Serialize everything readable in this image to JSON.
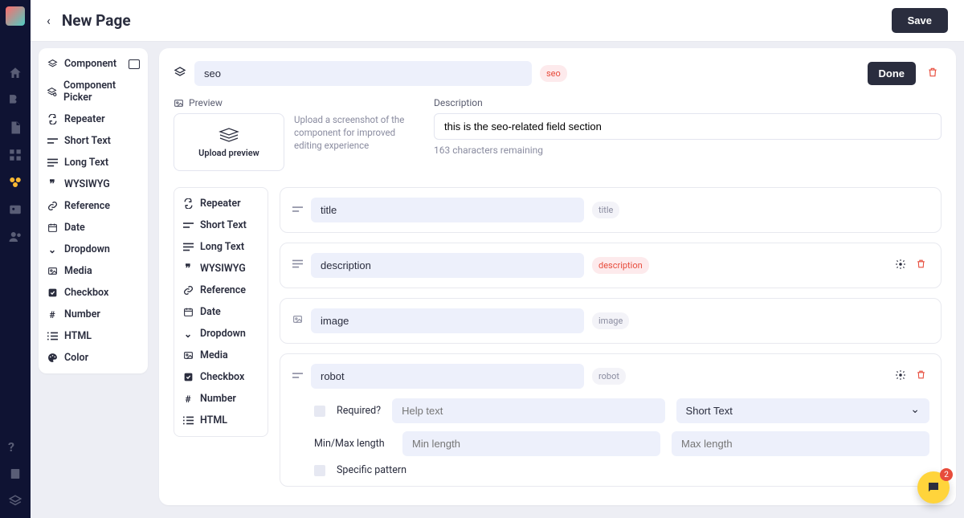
{
  "header": {
    "title": "New Page",
    "save_label": "Save"
  },
  "nav_rail": {
    "icons": [
      "home",
      "blog",
      "document",
      "grid",
      "honeycomb",
      "media",
      "users"
    ],
    "footer_icons": [
      "help",
      "book",
      "layers"
    ]
  },
  "field_types_left": [
    {
      "icon": "layers",
      "label": "Component",
      "extra": true
    },
    {
      "icon": "picker",
      "label": "Component Picker"
    },
    {
      "icon": "repeat",
      "label": "Repeater"
    },
    {
      "icon": "short",
      "label": "Short Text"
    },
    {
      "icon": "long",
      "label": "Long Text"
    },
    {
      "icon": "quote",
      "label": "WYSIWYG"
    },
    {
      "icon": "link",
      "label": "Reference"
    },
    {
      "icon": "date",
      "label": "Date"
    },
    {
      "icon": "chevron",
      "label": "Dropdown"
    },
    {
      "icon": "media",
      "label": "Media"
    },
    {
      "icon": "check",
      "label": "Checkbox"
    },
    {
      "icon": "hash",
      "label": "Number"
    },
    {
      "icon": "list",
      "label": "HTML"
    },
    {
      "icon": "palette",
      "label": "Color"
    }
  ],
  "component": {
    "name_value": "seo",
    "name_tag": "seo",
    "done_label": "Done",
    "preview_label": "Preview",
    "upload_label": "Upload preview",
    "upload_hint": "Upload a screenshot of the component for improved editing experience",
    "desc_label": "Description",
    "desc_value": "this is the seo-related field section",
    "desc_counter": "163 characters remaining"
  },
  "sub_field_types": [
    {
      "icon": "repeat",
      "label": "Repeater"
    },
    {
      "icon": "short",
      "label": "Short Text"
    },
    {
      "icon": "long",
      "label": "Long Text"
    },
    {
      "icon": "quote",
      "label": "WYSIWYG"
    },
    {
      "icon": "link",
      "label": "Reference"
    },
    {
      "icon": "date",
      "label": "Date"
    },
    {
      "icon": "chevron",
      "label": "Dropdown"
    },
    {
      "icon": "media",
      "label": "Media"
    },
    {
      "icon": "check",
      "label": "Checkbox"
    },
    {
      "icon": "hash",
      "label": "Number"
    },
    {
      "icon": "list",
      "label": "HTML"
    }
  ],
  "fields": [
    {
      "icon": "short",
      "name": "title",
      "tag": "title",
      "tag_red": false,
      "actions": false,
      "expanded": false
    },
    {
      "icon": "long",
      "name": "description",
      "tag": "description",
      "tag_red": true,
      "actions": true,
      "expanded": false
    },
    {
      "icon": "media",
      "name": "image",
      "tag": "image",
      "tag_red": false,
      "actions": false,
      "expanded": false
    },
    {
      "icon": "short",
      "name": "robot",
      "tag": "robot",
      "tag_red": false,
      "actions": true,
      "expanded": true
    }
  ],
  "expanded_details": {
    "required_label": "Required?",
    "help_placeholder": "Help text",
    "type_value": "Short Text",
    "minmax_label": "Min/Max length",
    "min_placeholder": "Min length",
    "max_placeholder": "Max length",
    "pattern_label": "Specific pattern"
  },
  "chat": {
    "badge": "2"
  }
}
